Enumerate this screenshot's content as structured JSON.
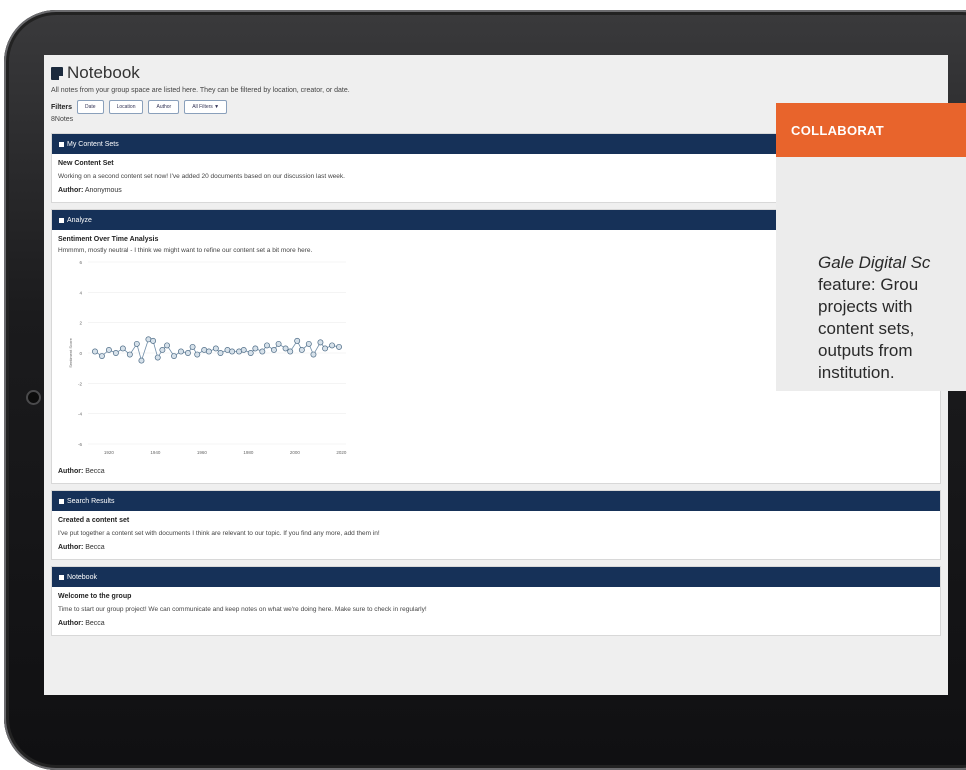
{
  "notebook": {
    "title": "Notebook",
    "description": "All notes from your group space are listed here. They can be filtered by location, creator, or date.",
    "filters_label": "Filters",
    "filters": [
      "Date",
      "Location",
      "Author",
      "All Filters ▼"
    ],
    "count": "8Notes"
  },
  "cards": [
    {
      "section": "My Content Sets",
      "heading": "New Content Set",
      "text": "Working on a second content set now! I've added 20 documents based on our discussion last week.",
      "author_label": "Author:",
      "author": "Anonymous"
    },
    {
      "section": "Analyze",
      "heading": "Sentiment Over Time Analysis",
      "text": "Hmmmm, mostly neutral - I think we might want to refine our content set a bit more here.",
      "author_label": "Author:",
      "author": "Becca"
    },
    {
      "section": "Search Results",
      "heading": "Created a content set",
      "text": "I've put together a content set with documents I think are relevant to our topic. If you find any more, add them in!",
      "author_label": "Author:",
      "author": "Becca"
    },
    {
      "section": "Notebook",
      "heading": "Welcome to the group",
      "text": "Time to start our group project! We can communicate and keep notes on what we're doing here. Make sure to check in regularly!",
      "author_label": "Author:",
      "author": "Becca"
    }
  ],
  "chart_data": {
    "type": "scatter",
    "ylabel": "Sentiment Score",
    "ylim": [
      -6,
      6
    ],
    "y_ticks": [
      "6",
      "4",
      "2",
      "0",
      "-2",
      "-4",
      "-6"
    ],
    "x_ticks": [
      "1920",
      "1940",
      "1960",
      "1980",
      "2000",
      "2020"
    ],
    "xlim": [
      1911,
      2022
    ],
    "series": [
      {
        "x": [
          1914,
          1917,
          1920,
          1923,
          1926,
          1929,
          1932,
          1934,
          1937,
          1939,
          1941,
          1943,
          1945,
          1948,
          1951,
          1954,
          1956,
          1958,
          1961,
          1963,
          1966,
          1968,
          1971,
          1973,
          1976,
          1978,
          1981,
          1983,
          1986,
          1988,
          1991,
          1993,
          1996,
          1998,
          2001,
          2003,
          2006,
          2008,
          2011,
          2013,
          2016,
          2019
        ],
        "y": [
          0.1,
          -0.2,
          0.2,
          0.0,
          0.3,
          -0.1,
          0.6,
          -0.5,
          0.9,
          0.8,
          -0.3,
          0.2,
          0.5,
          -0.2,
          0.1,
          0.0,
          0.4,
          -0.1,
          0.2,
          0.1,
          0.3,
          0.0,
          0.2,
          0.1,
          0.1,
          0.2,
          0.0,
          0.3,
          0.1,
          0.5,
          0.2,
          0.6,
          0.3,
          0.1,
          0.8,
          0.2,
          0.6,
          -0.1,
          0.7,
          0.3,
          0.5,
          0.4
        ]
      }
    ]
  },
  "overlay": {
    "heading": "COLLABORAT",
    "line1_italic": "Gale Digital Sc",
    "lines": [
      "feature: Grou",
      "projects with",
      "content sets,",
      "outputs from",
      "institution."
    ]
  }
}
